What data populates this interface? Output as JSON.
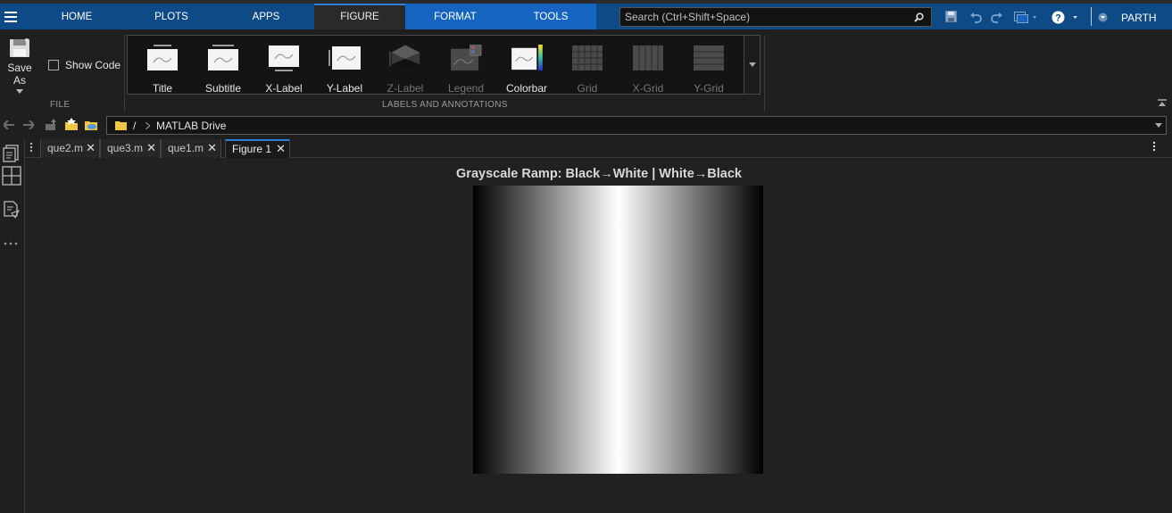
{
  "menubar": {
    "tabs": [
      {
        "label": "HOME"
      },
      {
        "label": "PLOTS"
      },
      {
        "label": "APPS"
      },
      {
        "label": "FIGURE"
      },
      {
        "label": "FORMAT"
      },
      {
        "label": "TOOLS"
      }
    ],
    "active_tab": "FIGURE",
    "search_placeholder": "Search (Ctrl+Shift+Space)",
    "user": "PARTH",
    "accent_color": "#0e4a86",
    "active_color": "#2f7fd6"
  },
  "toolstrip": {
    "file": {
      "save_as_label": "Save As",
      "show_code_label": "Show Code",
      "show_code_checked": false,
      "section_label": "FILE"
    },
    "labels": {
      "section_label": "LABELS AND ANNOTATIONS",
      "items": [
        {
          "label": "Title",
          "enabled": true,
          "icon": "title-icon"
        },
        {
          "label": "Subtitle",
          "enabled": true,
          "icon": "subtitle-icon"
        },
        {
          "label": "X-Label",
          "enabled": true,
          "icon": "xlabel-icon"
        },
        {
          "label": "Y-Label",
          "enabled": true,
          "icon": "ylabel-icon"
        },
        {
          "label": "Z-Label",
          "enabled": false,
          "icon": "zlabel-icon"
        },
        {
          "label": "Legend",
          "enabled": false,
          "icon": "legend-icon"
        },
        {
          "label": "Colorbar",
          "enabled": true,
          "icon": "colorbar-icon"
        },
        {
          "label": "Grid",
          "enabled": false,
          "icon": "grid-icon"
        },
        {
          "label": "X-Grid",
          "enabled": false,
          "icon": "xgrid-icon"
        },
        {
          "label": "Y-Grid",
          "enabled": false,
          "icon": "ygrid-icon"
        }
      ]
    }
  },
  "address": {
    "root": "/",
    "folder": "MATLAB Drive"
  },
  "editor_tabs": [
    {
      "label": "que2.m",
      "active": false
    },
    {
      "label": "que3.m",
      "active": false
    },
    {
      "label": "que1.m",
      "active": false
    },
    {
      "label": "Figure 1",
      "active": true
    }
  ],
  "figure": {
    "title": "Grayscale Ramp: Black→White | White→Black"
  }
}
